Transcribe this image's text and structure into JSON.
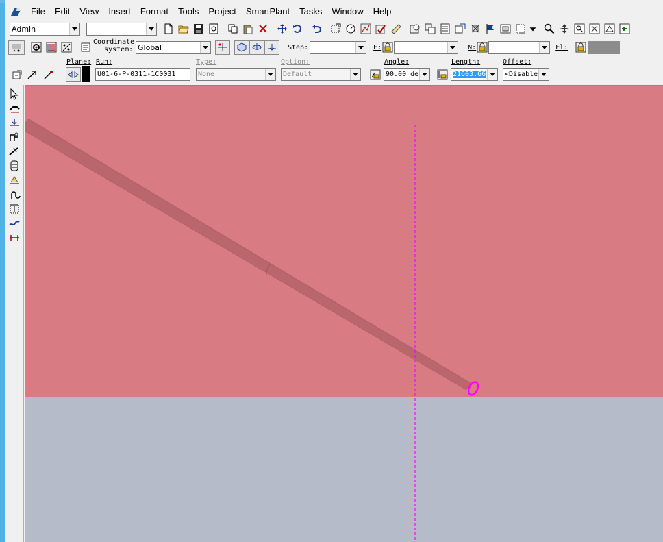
{
  "app": {
    "name": "SmartPlant 3D"
  },
  "menu": {
    "items": [
      "File",
      "Edit",
      "View",
      "Insert",
      "Format",
      "Tools",
      "Project",
      "SmartPlant",
      "Tasks",
      "Window",
      "Help"
    ]
  },
  "toolbar1": {
    "permission_group": "Admin",
    "filter_select": ""
  },
  "toolbar2": {
    "coordinate_label_line1": "Coordinate",
    "coordinate_label_line2": "system:",
    "coordinate_system": "Global",
    "step_label": "Step:",
    "step_value": "",
    "e_label": "E:",
    "e_value": "",
    "n_label": "N:",
    "n_value": "",
    "el_label": "El:"
  },
  "route_bar": {
    "plane_label": "Plane:",
    "run_label": "Run:",
    "run_value": "U01-6-P-0311-1C0031",
    "type_label": "Type:",
    "type_value": "None",
    "option_label": "Option:",
    "option_value": "Default",
    "angle_label": "Angle:",
    "angle_value": "90.00 de",
    "length_label": "Length:",
    "length_value": "21603.66",
    "offset_label": "Offset:",
    "offset_value": "<Disable"
  },
  "colors": {
    "wall": "#d87b82",
    "floor": "#b5bbc9",
    "pipe": "#e28d92",
    "highlight": "#ff00ff",
    "selection": "#3399ff"
  }
}
